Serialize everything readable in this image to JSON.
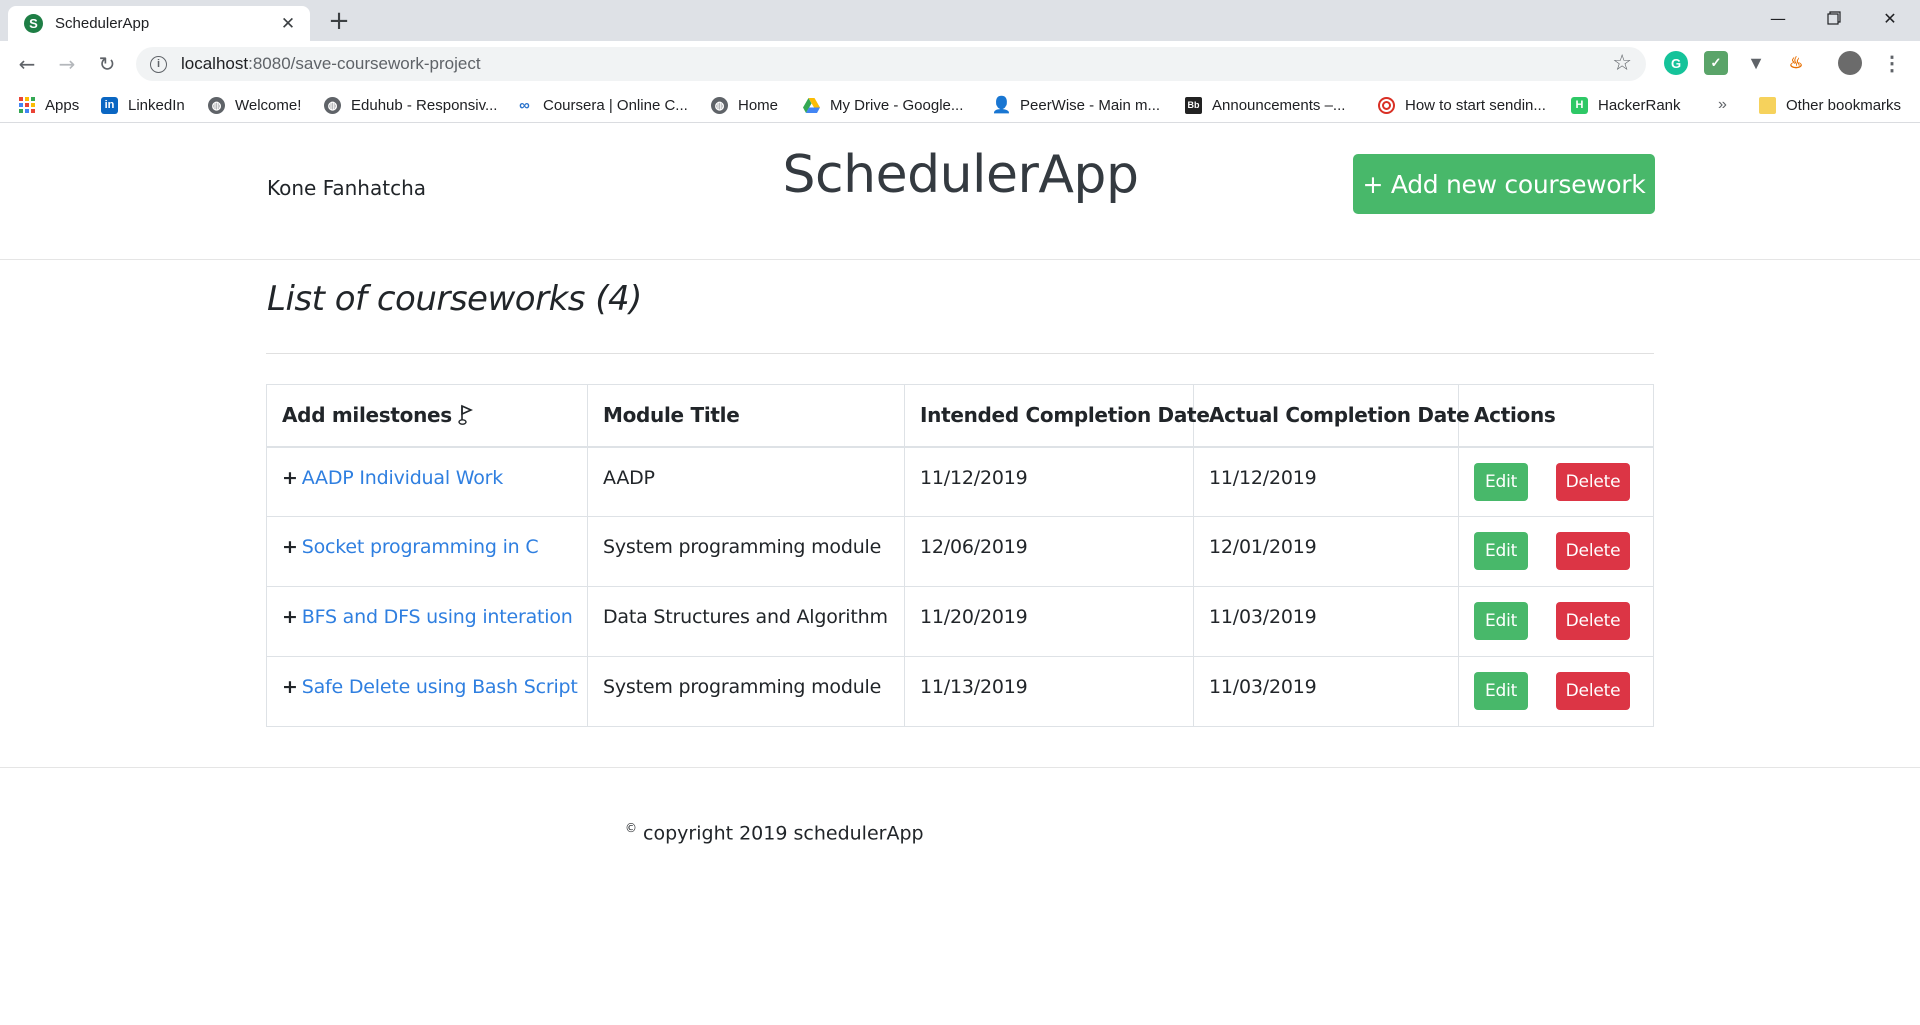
{
  "browser": {
    "tab_title": "SchedulerApp",
    "tab_favicon_letter": "S",
    "url_host": "localhost",
    "url_path": ":8080/save-coursework-project",
    "bookmarks": [
      {
        "label": "Apps",
        "icon": "apps-grid-icon"
      },
      {
        "label": "LinkedIn",
        "icon": "linkedin-icon"
      },
      {
        "label": "Welcome!",
        "icon": "globe-icon"
      },
      {
        "label": "Eduhub - Responsiv...",
        "icon": "globe-icon"
      },
      {
        "label": "Coursera | Online C...",
        "icon": "coursera-icon"
      },
      {
        "label": "Home",
        "icon": "globe-icon"
      },
      {
        "label": "My Drive - Google...",
        "icon": "google-drive-icon"
      },
      {
        "label": "PeerWise - Main m...",
        "icon": "peerwise-icon"
      },
      {
        "label": "Announcements –...",
        "icon": "blackboard-icon"
      },
      {
        "label": "How to start sendin...",
        "icon": "target-icon"
      },
      {
        "label": "HackerRank",
        "icon": "hackerrank-icon"
      }
    ],
    "more_bookmarks": "»",
    "other_bookmarks": "Other bookmarks"
  },
  "header": {
    "user_name": "Kone Fanhatcha",
    "app_title": "SchedulerApp",
    "add_button": "+ Add new coursework"
  },
  "main": {
    "heading": "List of courseworks (4)",
    "columns": {
      "milestones": "Add milestones",
      "module": "Module Title",
      "intended": "Intended Completion Date",
      "actual": "Actual Completion Date",
      "actions": "Actions"
    },
    "plus": "+",
    "edit_label": "Edit",
    "delete_label": "Delete",
    "rows": [
      {
        "title": "AADP Individual Work",
        "module": "AADP",
        "intended": "11/12/2019",
        "actual": "11/12/2019"
      },
      {
        "title": "Socket programming in C",
        "module": "System programming module",
        "intended": "12/06/2019",
        "actual": "12/01/2019"
      },
      {
        "title": "BFS and DFS using interation",
        "module": "Data Structures and Algorithm",
        "intended": "11/20/2019",
        "actual": "11/03/2019"
      },
      {
        "title": "Safe Delete using Bash Script",
        "module": "System programming module",
        "intended": "11/13/2019",
        "actual": "11/03/2019"
      }
    ]
  },
  "footer": {
    "copyright_symbol": "©",
    "text": " copyright 2019 schedulerApp"
  },
  "colors": {
    "success": "#48b86a",
    "danger": "#dc3545",
    "link": "#2f7fe0"
  }
}
